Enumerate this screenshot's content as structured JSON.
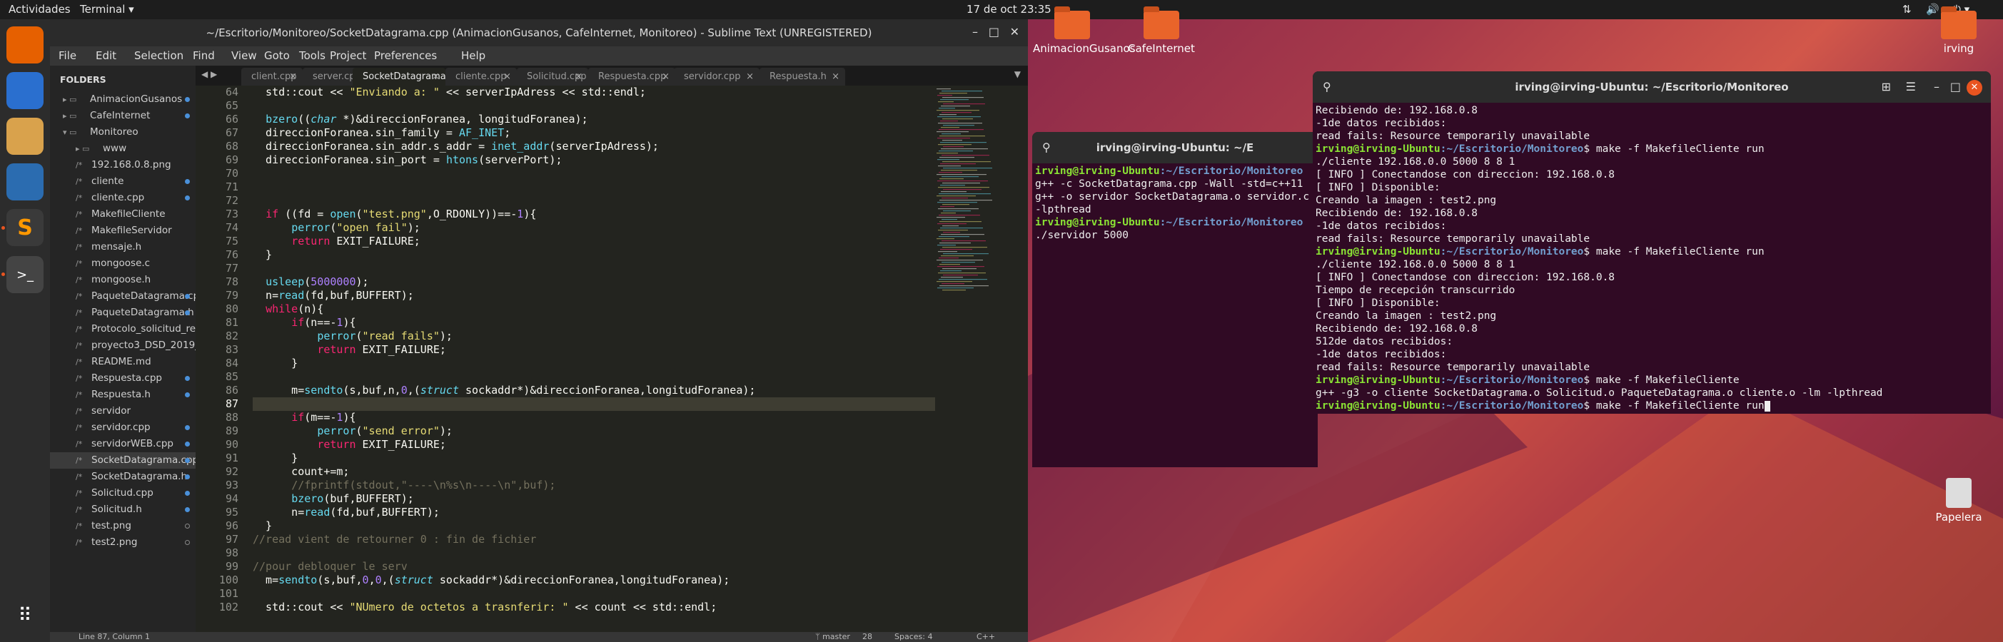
{
  "topbar": {
    "activities": "Actividades",
    "app": "Terminal ▾",
    "datetime": "17 de oct  23:35"
  },
  "sublime": {
    "title": "~/Escritorio/Monitoreo/SocketDatagrama.cpp (AnimacionGusanos, CafeInternet, Monitoreo) - Sublime Text (UNREGISTERED)",
    "menu": [
      "File",
      "Edit",
      "Selection",
      "Find",
      "View",
      "Goto",
      "Tools",
      "Project",
      "Preferences",
      "Help"
    ],
    "sidebar": {
      "header": "FOLDERS",
      "items": [
        "AnimacionGusanos",
        "CafeInternet",
        "Monitoreo",
        "www",
        "192.168.0.8.png",
        "cliente",
        "cliente.cpp",
        "MakefileCliente",
        "MakefileServidor",
        "mensaje.h",
        "mongoose.c",
        "mongoose.h",
        "PaqueteDatagrama.cpp",
        "PaqueteDatagrama.h",
        "Protocolo_solicitud_resp",
        "proyecto3_DSD_2019_",
        "README.md",
        "Respuesta.cpp",
        "Respuesta.h",
        "servidor",
        "servidor.cpp",
        "servidorWEB.cpp",
        "SocketDatagrama.cpp",
        "SocketDatagrama.h",
        "Solicitud.cpp",
        "Solicitud.h",
        "test.png",
        "test2.png"
      ]
    },
    "tabs": [
      "client.cpp",
      "server.cpp",
      "SocketDatagrama.cpp",
      "cliente.cpp",
      "Solicitud.cpp",
      "Respuesta.cpp",
      "servidor.cpp",
      "Respuesta.h"
    ],
    "line_numbers": [
      "64",
      "65",
      "66",
      "67",
      "68",
      "69",
      "70",
      "71",
      "72",
      "73",
      "74",
      "75",
      "76",
      "77",
      "78",
      "79",
      "80",
      "81",
      "82",
      "83",
      "84",
      "85",
      "86",
      "87",
      "88",
      "89",
      "90",
      "91",
      "92",
      "93",
      "94",
      "95",
      "96",
      "97",
      "98",
      "99",
      "100",
      "101",
      "102"
    ],
    "status": {
      "position": "Line 87, Column 1",
      "branch": "ᛘ master",
      "branch_count": "28",
      "spaces": "Spaces: 4",
      "syntax": "C++"
    }
  },
  "term_small": {
    "title": "irving@irving-Ubuntu: ~/E",
    "lines": [
      {
        "user": "irving@irving-Ubuntu",
        "path": ":~/Escritorio/Monitoreo",
        "text": ""
      },
      {
        "user": "",
        "path": "",
        "text": "g++ -c SocketDatagrama.cpp -Wall -std=c++11"
      },
      {
        "user": "",
        "path": "",
        "text": "g++ -o servidor SocketDatagrama.o servidor.c"
      },
      {
        "user": "",
        "path": "",
        "text": "-lpthread"
      },
      {
        "user": "irving@irving-Ubuntu",
        "path": ":~/Escritorio/Monitoreo",
        "text": ""
      },
      {
        "user": "",
        "path": "",
        "text": "./servidor 5000"
      }
    ]
  },
  "term_main": {
    "title": "irving@irving-Ubuntu: ~/Escritorio/Monitoreo",
    "lines": [
      {
        "user": "",
        "path": "",
        "text": "Recibiendo de: 192.168.0.8"
      },
      {
        "user": "",
        "path": "",
        "text": "-1de datos recibidos:"
      },
      {
        "user": "",
        "path": "",
        "text": "read fails: Resource temporarily unavailable"
      },
      {
        "user": "irving@irving-Ubuntu",
        "path": ":~/Escritorio/Monitoreo",
        "text": "$ make -f MakefileCliente run"
      },
      {
        "user": "",
        "path": "",
        "text": "./cliente 192.168.0.0 5000 8 8 1"
      },
      {
        "user": "",
        "path": "",
        "text": "[ INFO ] Conectandose con direccion: 192.168.0.8"
      },
      {
        "user": "",
        "path": "",
        "text": "[ INFO ] Disponible:"
      },
      {
        "user": "",
        "path": "",
        "text": "Creando la imagen : test2.png"
      },
      {
        "user": "",
        "path": "",
        "text": "Recibiendo de: 192.168.0.8"
      },
      {
        "user": "",
        "path": "",
        "text": "-1de datos recibidos:"
      },
      {
        "user": "",
        "path": "",
        "text": "read fails: Resource temporarily unavailable"
      },
      {
        "user": "irving@irving-Ubuntu",
        "path": ":~/Escritorio/Monitoreo",
        "text": "$ make -f MakefileCliente run"
      },
      {
        "user": "",
        "path": "",
        "text": "./cliente 192.168.0.0 5000 8 8 1"
      },
      {
        "user": "",
        "path": "",
        "text": "[ INFO ] Conectandose con direccion: 192.168.0.8"
      },
      {
        "user": "",
        "path": "",
        "text": "Tiempo de recepción transcurrido"
      },
      {
        "user": "",
        "path": "",
        "text": "[ INFO ] Disponible:"
      },
      {
        "user": "",
        "path": "",
        "text": "Creando la imagen : test2.png"
      },
      {
        "user": "",
        "path": "",
        "text": "Recibiendo de: 192.168.0.8"
      },
      {
        "user": "",
        "path": "",
        "text": "512de datos recibidos:"
      },
      {
        "user": "",
        "path": "",
        "text": "-1de datos recibidos:"
      },
      {
        "user": "",
        "path": "",
        "text": "read fails: Resource temporarily unavailable"
      },
      {
        "user": "irving@irving-Ubuntu",
        "path": ":~/Escritorio/Monitoreo",
        "text": "$ make -f MakefileCliente"
      },
      {
        "user": "",
        "path": "",
        "text": "g++ -g3 -o cliente SocketDatagrama.o Solicitud.o PaqueteDatagrama.o cliente.o -lm -lpthread"
      },
      {
        "user": "irving@irving-Ubuntu",
        "path": ":~/Escritorio/Monitoreo",
        "text": "$ make -f MakefileCliente run"
      }
    ]
  },
  "desktop": {
    "icons": [
      "AnimacionGusanos",
      "CafeInternet",
      "irving",
      "Papelera"
    ]
  }
}
